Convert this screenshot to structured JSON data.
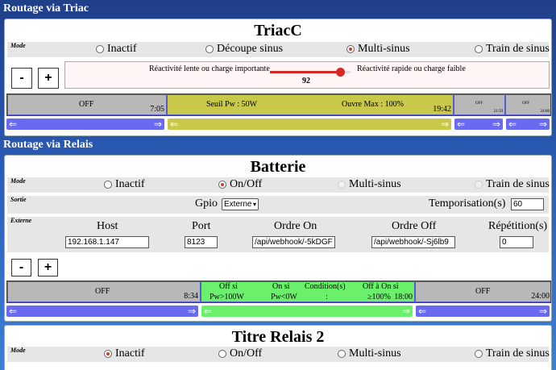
{
  "triac_section": {
    "title": "Routage via Triac"
  },
  "triac_card": {
    "title": "TriacC",
    "mode_label": "Mode",
    "modes": [
      "Inactif",
      "Découpe sinus",
      "Multi-sinus",
      "Train de sinus"
    ],
    "selected_mode": "Multi-sinus",
    "minus_label": "-",
    "plus_label": "+",
    "slider": {
      "left_label": "Réactivité lente ou charge importante",
      "right_label": "Réactivité rapide ou charge faible",
      "value_text": "92",
      "value": 92,
      "max": 100
    },
    "timeline": [
      {
        "label": "OFF",
        "end": "7:05"
      },
      {
        "label1": "Seuil Pw : 50W",
        "label2": "Ouvre Max : 100%",
        "end": "19:42"
      },
      {
        "label": "OFF",
        "end": "21:59"
      },
      {
        "label": "OFF",
        "end": "24:00"
      }
    ],
    "bar_arrows": {
      "left": "⇐",
      "right": "⇒"
    }
  },
  "relais_section": {
    "title": "Routage via Relais"
  },
  "batterie_card": {
    "title": "Batterie",
    "mode_label": "Mode",
    "modes": [
      "Inactif",
      "On/Off",
      "Multi-sinus",
      "Train de sinus"
    ],
    "selected_mode": "On/Off",
    "sortie_label": "Sortie",
    "gpio_label": "Gpio",
    "gpio_value": "Externe",
    "tempo_label": "Temporisation(s)",
    "tempo_value": "60",
    "externe_label": "Externe",
    "headers": {
      "host": "Host",
      "port": "Port",
      "on": "Ordre On",
      "off": "Ordre Off",
      "rep": "Répétition(s)"
    },
    "values": {
      "host": "192.168.1.147",
      "port": "8123",
      "on": "/api/webhook/-5kDGF",
      "off": "/api/webhook/-Sj6lb9",
      "rep": "0"
    },
    "minus_label": "-",
    "plus_label": "+",
    "timeline": [
      {
        "label": "OFF",
        "end": "8:34"
      },
      {
        "off_si": "Off si",
        "off_cond": "Pw>100W",
        "on_si": "On si",
        "on_cond": "Pw<0W",
        "cond_label": "Condition(s)",
        "cond_value": ":",
        "ofon_label": "Off à On si",
        "ofon_cond": "≥100%",
        "end": "18:00"
      },
      {
        "label": "OFF",
        "end": "24:00"
      }
    ]
  },
  "relais2_card": {
    "title": "Titre Relais 2",
    "mode_label": "Mode",
    "modes": [
      "Inactif",
      "On/Off",
      "Multi-sinus",
      "Train de sinus"
    ],
    "selected_mode": "Inactif"
  },
  "colors": {
    "segment_grey": "#b8b8b8",
    "segment_yellow": "#c8c84a",
    "segment_green": "#6bf06b",
    "bar_blue": "#6a6af0",
    "slider_red": "#d62828"
  }
}
